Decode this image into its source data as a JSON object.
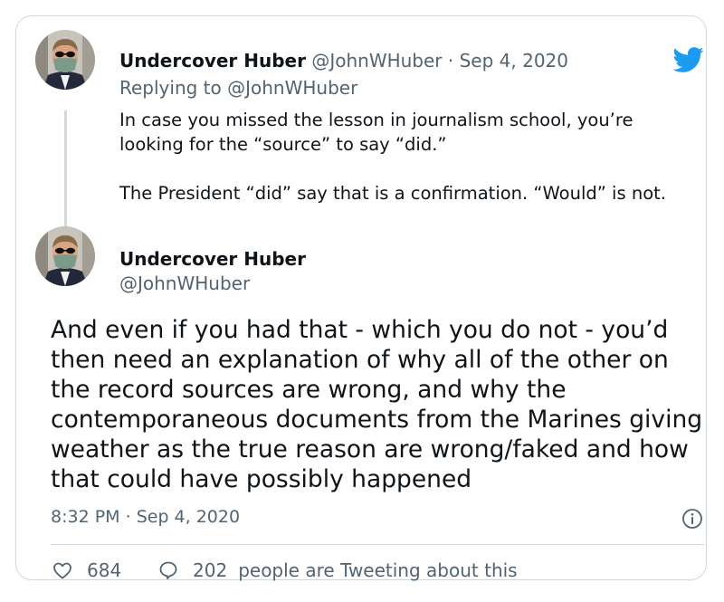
{
  "colors": {
    "brand": "#1d9bf0",
    "text_primary": "#0f1419",
    "text_secondary": "#536471",
    "border": "#cfd9de"
  },
  "icons": {
    "brand": "twitter-bird-icon",
    "info": "info-icon",
    "like": "heart-icon",
    "reply": "speech-bubble-icon"
  },
  "reply_tweet": {
    "author_name": "Undercover Huber",
    "handle": "@JohnWHuber",
    "separator": "·",
    "date": "Sep 4, 2020",
    "replying_prefix": "Replying to",
    "replying_to": "@JohnWHuber",
    "paragraph_1": "In case you missed the lesson in journalism school, you’re looking for the “source” to say “did.”",
    "paragraph_2": "The President “did” say that is a confirmation. “Would” is not."
  },
  "main_tweet": {
    "author_name": "Undercover Huber",
    "handle": "@JohnWHuber",
    "text": "And even if you had that - which you do not - you’d then need an explanation of why all of the other on the record sources are wrong, and why the contemporaneous documents from the Marines giving weather as the true reason are wrong/faked and how that could have possibly happened",
    "time": "8:32 PM",
    "separator": "·",
    "date": "Sep 4, 2020"
  },
  "stats": {
    "likes": "684",
    "tweeting_count": "202",
    "tweeting_label": "people are Tweeting about this"
  }
}
